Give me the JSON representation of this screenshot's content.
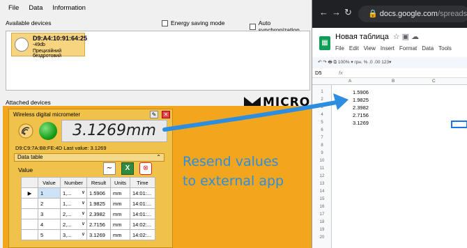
{
  "menu": [
    "File",
    "Data",
    "Information"
  ],
  "toolbar": {
    "available_label": "Available devices",
    "energy_label": "Energy saving mode",
    "auto_sync_label": "Auto synchronization"
  },
  "device_card": {
    "address": "D9:A4:10:91:64:25",
    "signal": "-49db",
    "name": "Прецизійний бездротовий"
  },
  "attached": {
    "label": "Attached devices",
    "brand": "MICRO"
  },
  "widget": {
    "title": "Wireless digital micrometer",
    "reading": "3.1269mm",
    "address_line": "D9:C9:7A:B8:FE:4D  Last value: 3.1269",
    "data_table_label": "Data table",
    "value_label": "Value",
    "icons": [
      "graph-icon",
      "excel-icon",
      "stop-icon"
    ]
  },
  "table": {
    "headers": [
      "",
      "Value",
      "Number",
      "Result",
      "Units",
      "Time"
    ],
    "rows": [
      {
        "value": "1",
        "number": "1,...",
        "result": "1.5906",
        "units": "mm",
        "time": "14:01:..."
      },
      {
        "value": "2",
        "number": "1,...",
        "result": "1.9825",
        "units": "mm",
        "time": "14:01:..."
      },
      {
        "value": "3",
        "number": "2,...",
        "result": "2.3982",
        "units": "mm",
        "time": "14:01:..."
      },
      {
        "value": "4",
        "number": "2,...",
        "result": "2.7156",
        "units": "mm",
        "time": "14:02:..."
      },
      {
        "value": "5",
        "number": "3,...",
        "result": "3.1269",
        "units": "mm",
        "time": "14:02:..."
      }
    ]
  },
  "browser": {
    "url_main": "docs.google.com",
    "url_rest": "/spreadshe",
    "doc_title": "Новая таблица",
    "doc_menu": [
      "File",
      "Edit",
      "View",
      "Insert",
      "Format",
      "Data",
      "Tools"
    ],
    "toolbar_text": "100%  ▾  грн.  %  .0  .00  123▾",
    "cell_ref": "D5",
    "fx": "fx",
    "columns": [
      "A",
      "B",
      "C"
    ],
    "values": [
      "1.5906",
      "1.9825",
      "2.3982",
      "2.7156",
      "3.1269"
    ],
    "row_numbers": [
      "1",
      "2",
      "3",
      "4",
      "5",
      "6",
      "7",
      "8",
      "9",
      "10",
      "11",
      "12",
      "13",
      "14",
      "15",
      "16",
      "17",
      "18",
      "19",
      "20"
    ]
  },
  "callout": {
    "line1": "Resend values",
    "line2": "to external app"
  },
  "colors": {
    "panel_orange": "#f2a61d",
    "callout_blue": "#2d8de0",
    "sheets_green": "#0f9d58"
  }
}
